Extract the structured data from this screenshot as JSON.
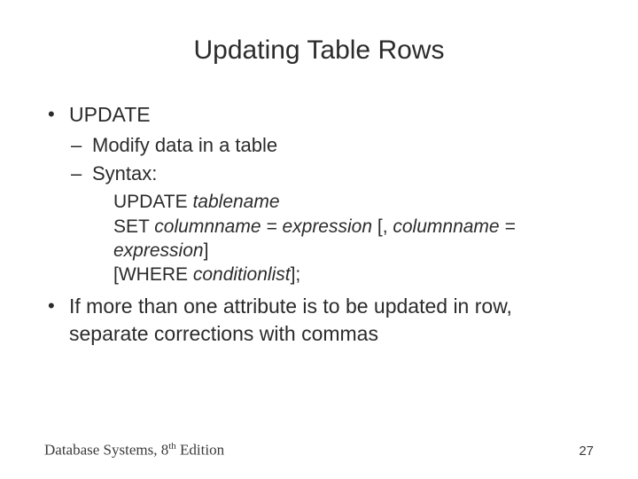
{
  "title": "Updating Table Rows",
  "bullets": {
    "b1": "UPDATE",
    "b1_sub1": "Modify data in a table",
    "b1_sub2": "Syntax:",
    "b2": "If more than one attribute is to be updated in row, separate corrections with commas"
  },
  "code": {
    "l1_a": "UPDATE ",
    "l1_b": "tablename",
    "l2_a": "SET ",
    "l2_b": "columnname = expression ",
    "l2_c": "[, ",
    "l2_d": "columnname = expression",
    "l2_e": "]",
    "l3_a": "[WHERE ",
    "l3_b": "conditionlist",
    "l3_c": "];"
  },
  "footer": {
    "book": "Database Systems, 8",
    "ord": "th",
    "edition": " Edition",
    "page": "27"
  }
}
